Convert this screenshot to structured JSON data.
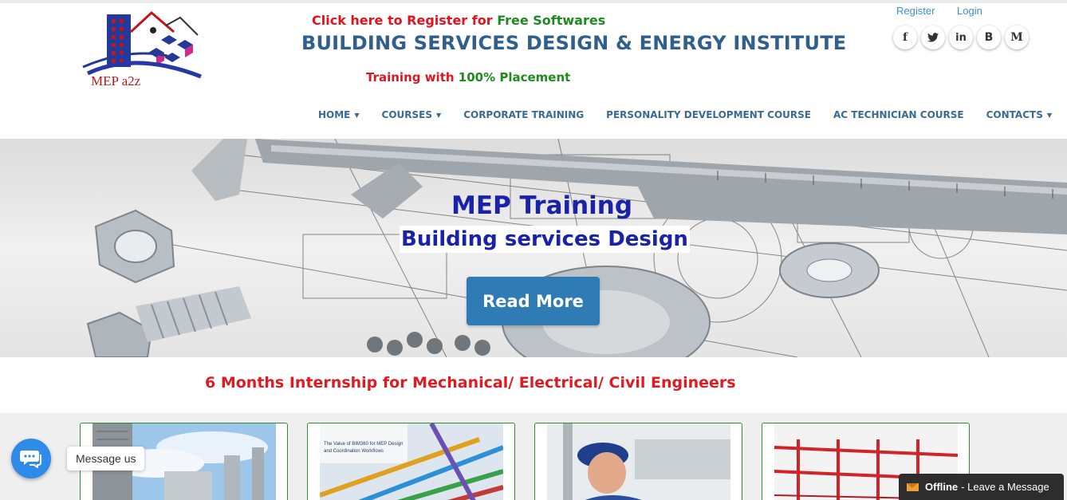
{
  "header": {
    "logo_text": "MEP a2z",
    "promo_register": {
      "red": "Click here to Register for ",
      "green": "Free Softwares"
    },
    "site_title": "BUILDING SERVICES DESIGN & ENERGY INSTITUTE",
    "promo_training": {
      "red": "Training with ",
      "green": "100% Placement"
    },
    "auth": {
      "register": "Register",
      "login": "Login"
    },
    "social": [
      {
        "icon": "facebook-icon",
        "glyph": "f"
      },
      {
        "icon": "twitter-icon",
        "glyph": "🐦"
      },
      {
        "icon": "linkedin-icon",
        "glyph": "in"
      },
      {
        "icon": "blogger-icon",
        "glyph": "B"
      },
      {
        "icon": "medium-icon",
        "glyph": "M"
      }
    ]
  },
  "nav": {
    "items": [
      {
        "label": "HOME",
        "dropdown": true
      },
      {
        "label": "COURSES",
        "dropdown": true
      },
      {
        "label": "CORPORATE TRAINING",
        "dropdown": false
      },
      {
        "label": "PERSONALITY DEVELOPMENT COURSE",
        "dropdown": false
      },
      {
        "label": "AC TECHNICIAN COURSE",
        "dropdown": false
      },
      {
        "label": "CONTACTS",
        "dropdown": true
      }
    ]
  },
  "hero": {
    "title": "MEP Training",
    "subtitle": "Building services Design",
    "button": "Read More"
  },
  "internship": "6 Months Internship for Mechanical/ Electrical/ Civil Engineers",
  "cards": [
    {
      "name": "card-hvac-units"
    },
    {
      "name": "card-bim-mep",
      "caption": "The Value of BIM360 for MEP Design and Coordination Workflows"
    },
    {
      "name": "card-technician"
    },
    {
      "name": "card-fire-sprinkler"
    }
  ],
  "chat": {
    "label": "Message us"
  },
  "offline": {
    "status": "Offline",
    "text": "- Leave a Message"
  },
  "colors": {
    "brand_blue": "#2f5f8a",
    "accent_red": "#df1b22",
    "accent_green": "#1f8a1f",
    "button_blue": "#2f7bb5",
    "hero_text": "#1a22a8"
  }
}
